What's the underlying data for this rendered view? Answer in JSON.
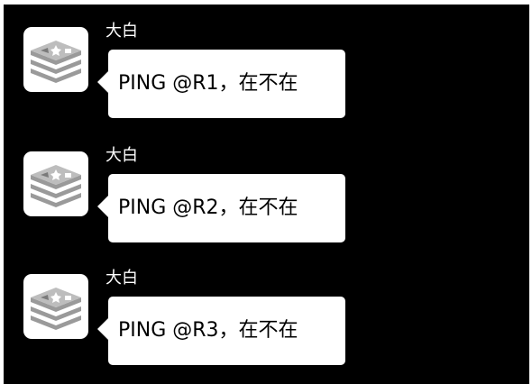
{
  "messages": [
    {
      "sender": "大白",
      "text": "PING @R1，在不在"
    },
    {
      "sender": "大白",
      "text": "PING @R2，在不在"
    },
    {
      "sender": "大白",
      "text": "PING @R3，在不在"
    }
  ]
}
